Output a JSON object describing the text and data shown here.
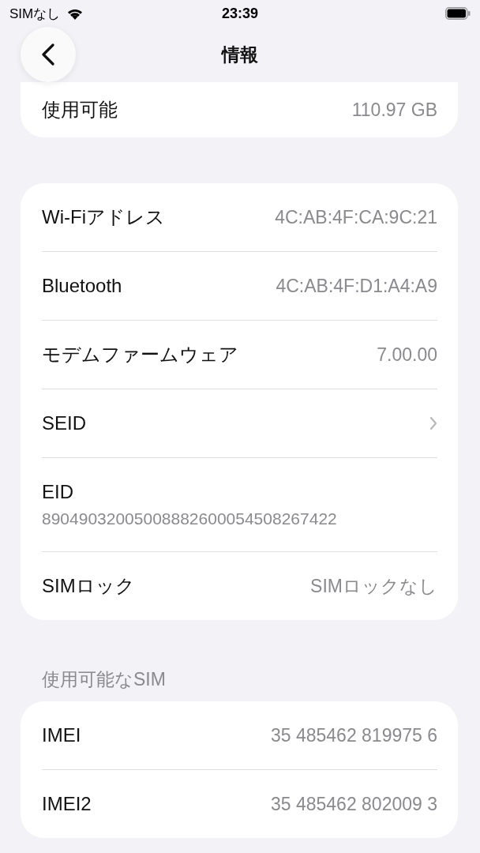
{
  "status_bar": {
    "carrier": "SIMなし",
    "time": "23:39"
  },
  "nav": {
    "title": "情報"
  },
  "groups": [
    {
      "rows": [
        {
          "kind": "value",
          "label": "使用可能",
          "value": "110.97 GB"
        }
      ]
    },
    {
      "rows": [
        {
          "kind": "value",
          "label": "Wi-Fiアドレス",
          "value": "4C:AB:4F:CA:9C:21"
        },
        {
          "kind": "value",
          "label": "Bluetooth",
          "value": "4C:AB:4F:D1:A4:A9"
        },
        {
          "kind": "value",
          "label": "モデムファームウェア",
          "value": "7.00.00"
        },
        {
          "kind": "link",
          "label": "SEID"
        },
        {
          "kind": "stacked",
          "label": "EID",
          "value": "89049032005008882600054508267422"
        },
        {
          "kind": "value",
          "label": "SIMロック",
          "value": "SIMロックなし"
        }
      ]
    },
    {
      "header": "使用可能なSIM",
      "rows": [
        {
          "kind": "value",
          "label": "IMEI",
          "value": "35 485462 819975 6"
        },
        {
          "kind": "value",
          "label": "IMEI2",
          "value": "35 485462 802009 3"
        }
      ]
    }
  ]
}
